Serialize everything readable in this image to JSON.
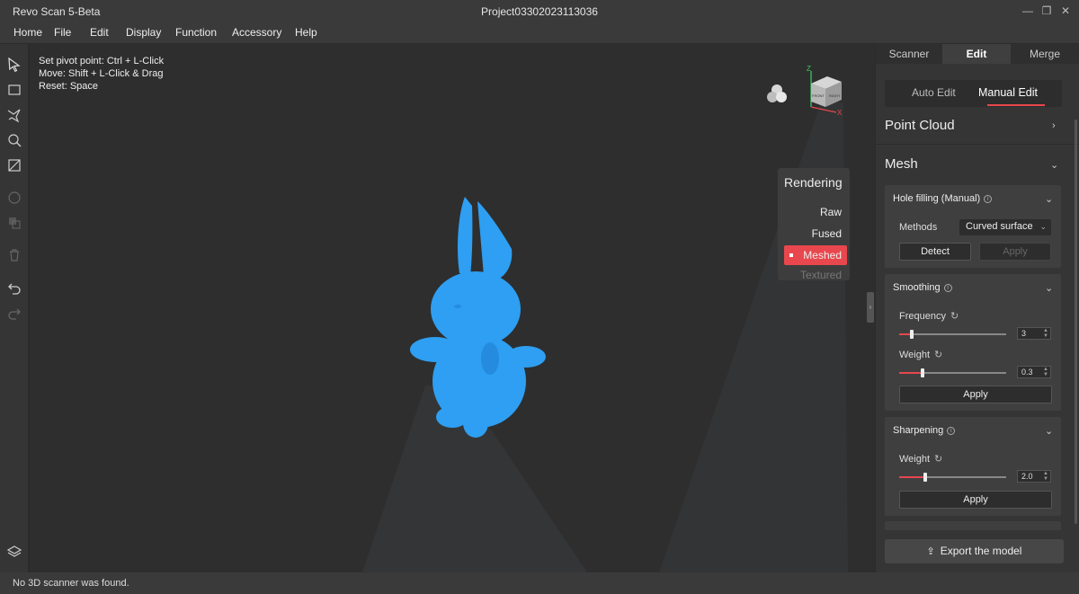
{
  "titlebar": {
    "app_title": "Revo Scan 5-Beta",
    "project": "Project03302023113036"
  },
  "menubar": {
    "items": [
      "Home",
      "File",
      "Edit",
      "Display",
      "Function",
      "Accessory",
      "Help"
    ]
  },
  "viewport": {
    "hints": [
      "Set pivot point:  Ctrl +  L-Click",
      "Move:  Shift +  L-Click & Drag",
      "Reset:  Space"
    ],
    "model_color": "#2e9ff2",
    "nav_cube": {
      "front": "FRONT",
      "right": "RIGHT",
      "z_axis": "Z",
      "x_axis": "X"
    }
  },
  "rendering": {
    "title": "Rendering",
    "options": [
      {
        "label": "Raw",
        "state": "normal"
      },
      {
        "label": "Fused",
        "state": "normal"
      },
      {
        "label": "Meshed",
        "state": "active"
      },
      {
        "label": "Textured",
        "state": "disabled"
      }
    ]
  },
  "right_panel": {
    "tabs": [
      "Scanner",
      "Edit",
      "Merge"
    ],
    "active_tab": "Edit",
    "subtabs": [
      "Auto Edit",
      "Manual Edit"
    ],
    "active_subtab": "Manual Edit",
    "point_cloud_title": "Point Cloud",
    "mesh_title": "Mesh",
    "hole_filling": {
      "title": "Hole filling (Manual)",
      "methods_label": "Methods",
      "method_value": "Curved surface",
      "detect_label": "Detect",
      "apply_label": "Apply"
    },
    "smoothing": {
      "title": "Smoothing",
      "frequency_label": "Frequency",
      "frequency_value": "3",
      "frequency_fraction": 0.12,
      "weight_label": "Weight",
      "weight_value": "0.3",
      "weight_fraction": 0.22,
      "apply_label": "Apply"
    },
    "sharpening": {
      "title": "Sharpening",
      "weight_label": "Weight",
      "weight_value": "2.0",
      "weight_fraction": 0.24,
      "apply_label": "Apply"
    },
    "export_label": "Export the model"
  },
  "status": {
    "text": "No 3D scanner was found."
  },
  "colors": {
    "accent": "#e8474d",
    "background": "#2e2e2e",
    "panel": "#353535"
  }
}
